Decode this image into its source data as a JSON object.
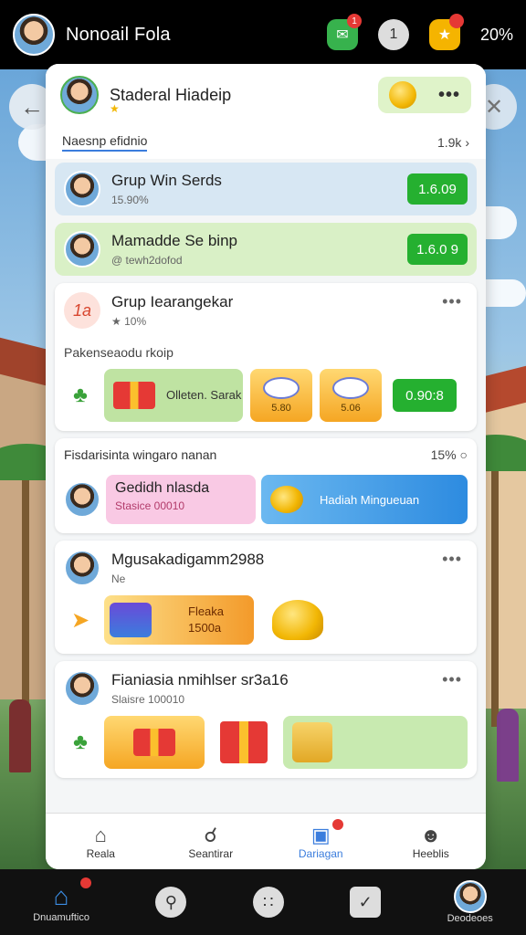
{
  "status_bar": {
    "title": "Nonoail Fola",
    "chat_badge": "1",
    "info_badge": "1",
    "battery": "20%"
  },
  "profile": {
    "name": "Staderal Hiadeip"
  },
  "section": {
    "label": "Naesnp efidnio",
    "count": "1.9k"
  },
  "groups": [
    {
      "name": "Grup Win Serds",
      "meta": "15.90%",
      "button": "1.6.09"
    },
    {
      "name": "Mamadde Se binp",
      "meta": "@ tewh2dofod",
      "button": "1.6.0 9"
    }
  ],
  "card_a": {
    "logo": "1a",
    "title": "Grup Iearangekar",
    "meta": "10%",
    "subtitle": "Pakenseaodu rkoip",
    "tile_label": "Olleten. Sarak",
    "price_1": "5.80",
    "price_2": "5.06",
    "button": "0.90:8"
  },
  "card_b": {
    "title": "Fisdarisinta wingaro nanan",
    "count": "15%",
    "pink_title": "Gedidh nlasda",
    "pink_sub": "Stasice 00010",
    "blue_label": "Hadiah Mingueuan"
  },
  "card_c": {
    "title": "Mgusakadigamm2988",
    "meta": "Ne",
    "tile_label": "Fleaka",
    "tile_value": "1500a"
  },
  "card_d": {
    "title": "Fianiasia nmihlser sr3a16",
    "meta": "Slaisre 100010"
  },
  "bottom_nav": [
    {
      "label": "Reala"
    },
    {
      "label": "Seantirar"
    },
    {
      "label": "Dariagan"
    },
    {
      "label": "Heeblis"
    }
  ],
  "dock": {
    "left_label": "Dnuamuftico",
    "right_label": "Deodeoes"
  }
}
